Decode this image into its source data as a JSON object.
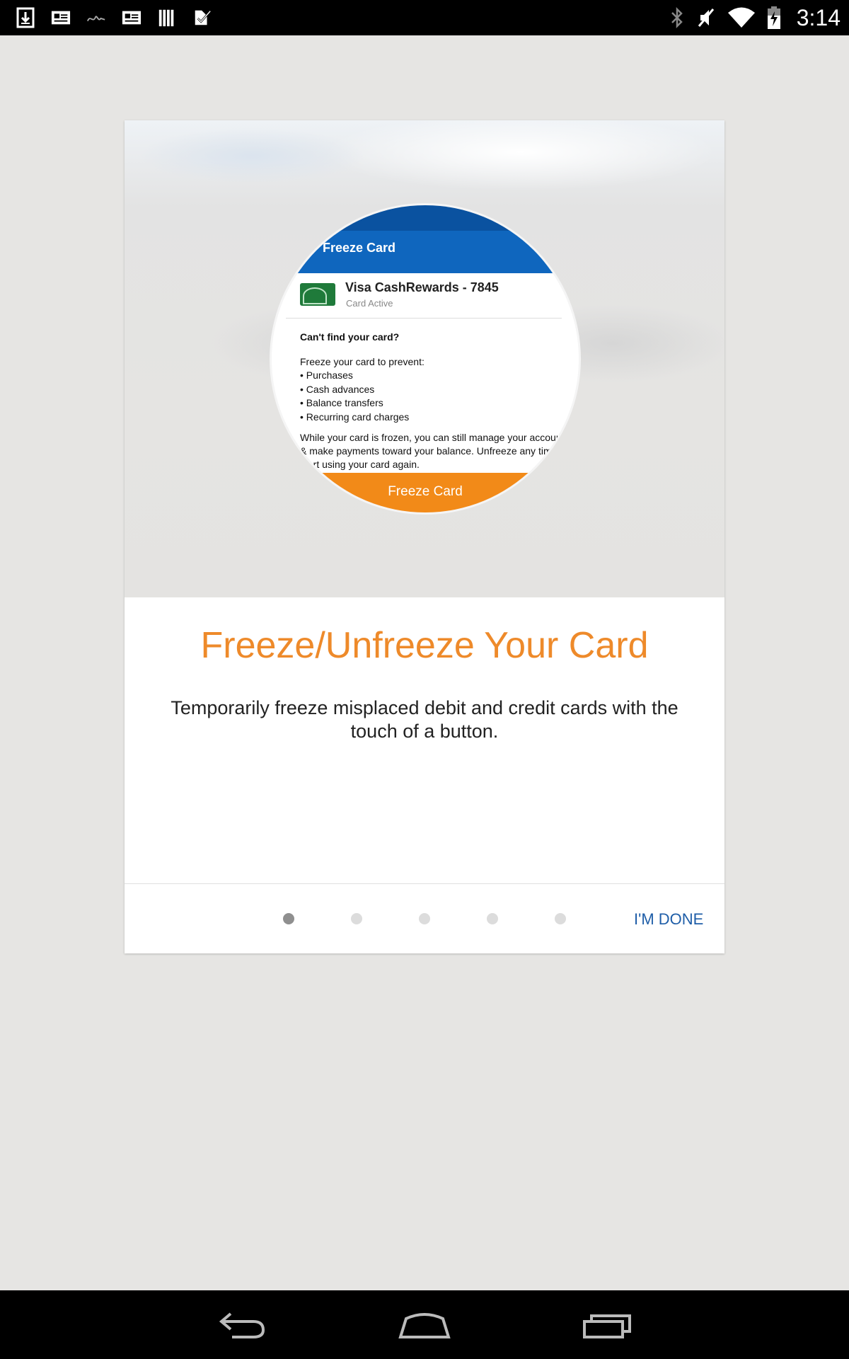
{
  "status_bar": {
    "time": "3:14",
    "left_icons": [
      "download-icon",
      "news-icon",
      "signature-icon",
      "news-icon",
      "library-icon",
      "tasks-icon"
    ],
    "right_icons": [
      "bluetooth-icon",
      "mute-icon",
      "wifi-icon",
      "battery-charging-icon"
    ]
  },
  "dialog": {
    "hero": {
      "header_title": "Freeze Card",
      "card_name": "Visa CashRewards - 7845",
      "card_status": "Card Active",
      "question": "Can't find your card?",
      "prevent_intro": "Freeze your card to prevent:",
      "prevent_items": [
        "• Purchases",
        "• Cash advances",
        "• Balance transfers",
        "• Recurring card charges"
      ],
      "note": "While your card is frozen, you can still manage your account & make payments toward your balance. Unfreeze any time to start using your card again.",
      "button_label": "Freeze Card"
    },
    "title": "Freeze/Unfreeze Your Card",
    "description": "Temporarily freeze misplaced debit and credit cards with the touch of a button.",
    "pager": {
      "total": 5,
      "current": 1
    },
    "done_label": "I'M DONE"
  },
  "colors": {
    "accent_orange": "#ee8a2a",
    "header_blue": "#0f66be",
    "link_blue": "#1f5ea8",
    "background": "#e6e5e3"
  },
  "nav_bar": {
    "buttons": [
      "back-icon",
      "home-icon",
      "recents-icon"
    ]
  }
}
